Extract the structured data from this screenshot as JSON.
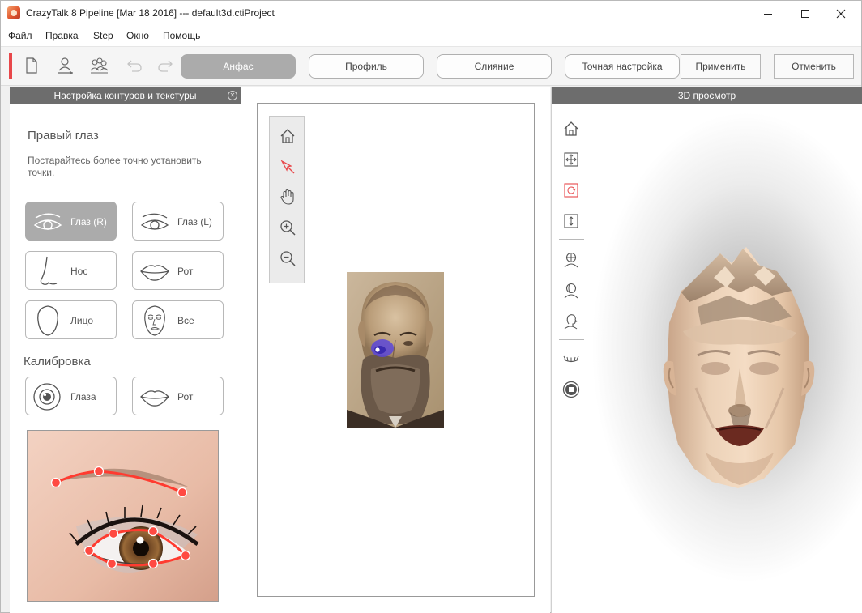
{
  "window": {
    "title": "CrazyTalk 8 Pipeline [Mar 18 2016] --- default3d.ctiProject",
    "controls": [
      "minimize-icon",
      "maximize-icon",
      "close-icon"
    ]
  },
  "menu": {
    "items": [
      "Файл",
      "Правка",
      "Step",
      "Окно",
      "Помощь"
    ]
  },
  "toolbar": {
    "icons": [
      "new-file-icon",
      "single-person-icon",
      "group-icon",
      "undo-icon",
      "redo-icon"
    ],
    "steps": [
      {
        "label": "Анфас",
        "active": true
      },
      {
        "label": "Профиль",
        "active": false
      },
      {
        "label": "Слияние",
        "active": false
      },
      {
        "label": "Точная настройка",
        "active": false
      }
    ],
    "apply_label": "Применить",
    "cancel_label": "Отменить"
  },
  "left_panel": {
    "header": "Настройка контуров и текстуры",
    "section_title": "Правый глаз",
    "hint": "Постарайтесь более точно установить точки.",
    "features": [
      {
        "label": "Глаз (R)",
        "icon": "eye-right-icon",
        "active": true
      },
      {
        "label": "Глаз (L)",
        "icon": "eye-left-icon",
        "active": false
      },
      {
        "label": "Нос",
        "icon": "nose-icon",
        "active": false
      },
      {
        "label": "Рот",
        "icon": "mouth-icon",
        "active": false
      },
      {
        "label": "Лицо",
        "icon": "face-outline-icon",
        "active": false
      },
      {
        "label": "Все",
        "icon": "full-face-icon",
        "active": false
      }
    ],
    "calibration_title": "Калибровка",
    "calibration": [
      {
        "label": "Глаза",
        "icon": "eye-calibration-icon"
      },
      {
        "label": "Рот",
        "icon": "mouth-calibration-icon"
      }
    ]
  },
  "center": {
    "view_tools": [
      "home-icon",
      "select-arrow-icon",
      "pan-hand-icon",
      "zoom-in-icon",
      "zoom-out-icon"
    ]
  },
  "right_panel": {
    "header": "3D просмотр",
    "tools": [
      "home-icon",
      "move-icon",
      "rotate-icon",
      "zoom-vertical-icon",
      "head-front-icon",
      "head-three-quarter-icon",
      "head-side-icon",
      "eyelashes-icon",
      "record-stop-icon"
    ]
  },
  "colors": {
    "accent": "#e8474a",
    "panel_header": "#6d6d6d",
    "active_button": "#ababab",
    "eye_marker": "#5a46d8"
  }
}
